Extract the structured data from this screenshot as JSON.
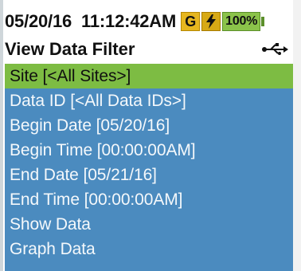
{
  "status_bar": {
    "date": "05/20/16",
    "time": "11:12:42AM",
    "gps_badge": "G",
    "power_icon": "lightning-bolt",
    "battery_text": "100%",
    "colors": {
      "gps_badge": "#e6b61f",
      "power_badge": "#d7a915",
      "battery": "#8bc34a"
    }
  },
  "header": {
    "title": "View Data Filter",
    "connection_icon": "usb-icon"
  },
  "menu": {
    "items": [
      {
        "label": "Site [<All Sites>]",
        "selected": true
      },
      {
        "label": "Data ID [<All Data IDs>]",
        "selected": false
      },
      {
        "label": "Begin Date [05/20/16]",
        "selected": false
      },
      {
        "label": "Begin Time [00:00:00AM]",
        "selected": false
      },
      {
        "label": "End Date [05/21/16]",
        "selected": false
      },
      {
        "label": "End Time [00:00:00AM]",
        "selected": false
      },
      {
        "label": "Show Data",
        "selected": false
      },
      {
        "label": "Graph Data",
        "selected": false
      }
    ],
    "colors": {
      "panel_background": "#4b8bbf",
      "selected_background": "#7dbc43",
      "text": "#f4f8fb",
      "selected_text": "#101010"
    }
  }
}
